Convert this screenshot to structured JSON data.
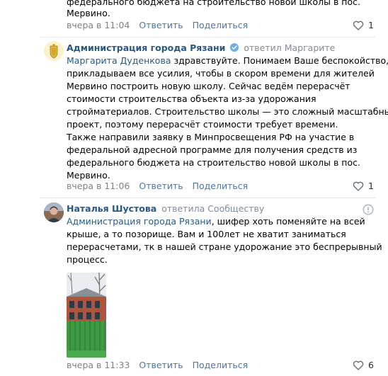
{
  "top_comment": {
    "lines": [
      "федерального бюджета на строительство новой школы в пос.",
      "Мервино."
    ],
    "time": "вчера в 11:04",
    "reply_label": "Ответить",
    "share_label": "Поделиться",
    "likes": "1"
  },
  "comment_admin": {
    "author": "Администрация города Рязани",
    "answered_to": "ответил Маргарите",
    "mention": "Маргарита Дуденкова",
    "first_line_rest": " здравствуйте. Понимаем Ваше беспокойство,",
    "lines": [
      "прикладываем все усилия, чтобы в скором времени для жителей",
      "Мервино построить новую школу. Сейчас ведём перерасчёт",
      "стоимости строительства объекта из-за удорожания",
      "стройматериалов. Строительство школы — это сложный масштабный",
      "проект, поэтому перерасчёт стоимости требует времени.",
      "Также направили заявку в Минпросвещения РФ на участие в",
      "федеральной адресной программе для получения средств из",
      "федерального бюджета на строительство новой школы в пос.",
      "Мервино."
    ],
    "time": "вчера в 11:06",
    "reply_label": "Ответить",
    "share_label": "Поделиться",
    "likes": "1"
  },
  "comment_natalia": {
    "author": "Наталья Шустова",
    "answered_to": "ответила Сообществу",
    "mention": "Администрация города Рязани",
    "first_line_rest": ", шифер хоть поменяйте на всей",
    "lines": [
      "крыше, а то позорище. Вам и 100лет не хватит заниматься",
      "перерасчетами, тк в нашей стране удорожание это беспрерывный",
      "процесс."
    ],
    "time": "вчера в 11:33",
    "reply_label": "Ответить",
    "share_label": "Поделиться",
    "likes": "6"
  },
  "colors": {
    "link": "#2a5885",
    "action": "#4a76a8",
    "meta": "#828282",
    "verified": "#71aaeb"
  },
  "icons": {
    "like": "heart-icon",
    "verified": "verified-check-icon",
    "report": "report-icon"
  }
}
